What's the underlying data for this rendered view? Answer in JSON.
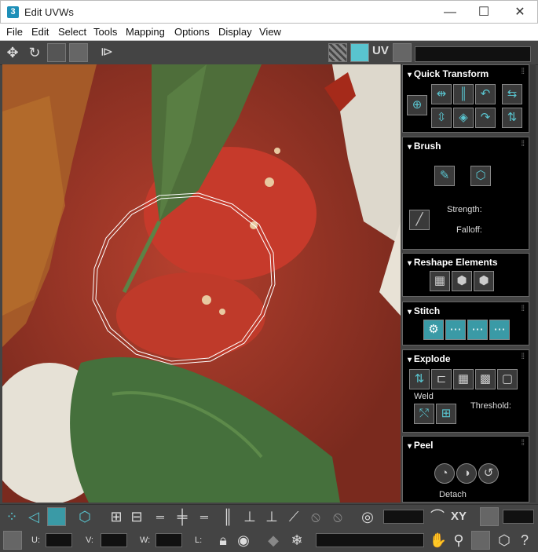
{
  "window": {
    "title": "Edit UVWs",
    "app_icon_text": "3",
    "minimize": "—",
    "maximize": "☐",
    "close": "✕"
  },
  "menu": [
    "File",
    "Edit",
    "Select",
    "Tools",
    "Mapping",
    "Options",
    "Display",
    "View"
  ],
  "toolbar": {
    "uv_label": "UV"
  },
  "rollouts": {
    "quick_transform": {
      "title": "Quick Transform"
    },
    "brush": {
      "title": "Brush",
      "strength_label": "Strength:",
      "falloff_label": "Falloff:"
    },
    "reshape": {
      "title": "Reshape Elements"
    },
    "stitch": {
      "title": "Stitch"
    },
    "explode": {
      "title": "Explode",
      "weld_label": "Weld",
      "threshold_label": "Threshold:"
    },
    "peel": {
      "title": "Peel",
      "detach_label": "Detach"
    }
  },
  "bottom": {
    "xy_label": "XY",
    "u_label": "U:",
    "v_label": "V:",
    "w_label": "W:",
    "l_label": "L:"
  },
  "colors": {
    "accent": "#3a9aa6",
    "icon_teal": "#59c4cf",
    "panel_bg": "#444444",
    "rollout_bg": "#000000"
  }
}
